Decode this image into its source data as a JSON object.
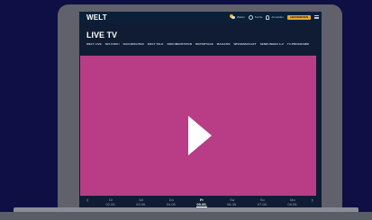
{
  "site": {
    "logo": "WELT",
    "weather_label": "Wetter",
    "search_label": "Suche",
    "login_label": "Anmelden",
    "subscribe_label": "ABONNIEREN"
  },
  "page": {
    "title": "LIVE TV"
  },
  "nav": {
    "tabs": [
      "WELT LIVE",
      "N24 DOKU",
      "NACHRICHTEN",
      "WELT TALK",
      "DOKUMENTATION",
      "REPORTAGE",
      "MAGAZIN",
      "WISSENSCHAFT",
      "SENDUNGEN A-Z",
      "TV-PROGRAMM"
    ]
  },
  "schedule": {
    "days": [
      {
        "name": "Di",
        "date": "02.05."
      },
      {
        "name": "Mi",
        "date": "03.05."
      },
      {
        "name": "Do",
        "date": "04.05."
      },
      {
        "name": "Fr",
        "date": "05.05."
      },
      {
        "name": "Sa",
        "date": "06.05."
      },
      {
        "name": "So",
        "date": "07.05."
      },
      {
        "name": "Mo",
        "date": "08.05."
      }
    ],
    "active_index": 3
  },
  "colors": {
    "background": "#0f0f45",
    "video": "#b83d86",
    "accent": "#e8a62f"
  }
}
